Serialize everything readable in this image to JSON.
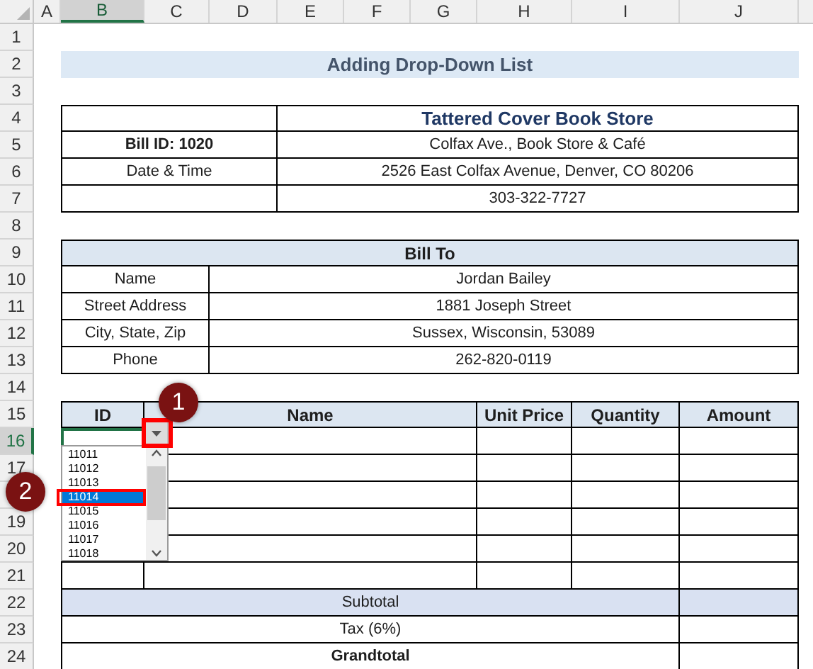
{
  "column_headers": [
    {
      "label": "A",
      "selected": false
    },
    {
      "label": "B",
      "selected": true
    },
    {
      "label": "C",
      "selected": false
    },
    {
      "label": "D",
      "selected": false
    },
    {
      "label": "E",
      "selected": false
    },
    {
      "label": "F",
      "selected": false
    },
    {
      "label": "G",
      "selected": false
    },
    {
      "label": "H",
      "selected": false
    },
    {
      "label": "I",
      "selected": false
    },
    {
      "label": "J",
      "selected": false
    }
  ],
  "row_headers": [
    {
      "label": "1",
      "selected": false
    },
    {
      "label": "2",
      "selected": false
    },
    {
      "label": "3",
      "selected": false
    },
    {
      "label": "4",
      "selected": false
    },
    {
      "label": "5",
      "selected": false
    },
    {
      "label": "6",
      "selected": false
    },
    {
      "label": "7",
      "selected": false
    },
    {
      "label": "8",
      "selected": false
    },
    {
      "label": "9",
      "selected": false
    },
    {
      "label": "10",
      "selected": false
    },
    {
      "label": "11",
      "selected": false
    },
    {
      "label": "12",
      "selected": false
    },
    {
      "label": "13",
      "selected": false
    },
    {
      "label": "14",
      "selected": false
    },
    {
      "label": "15",
      "selected": false
    },
    {
      "label": "16",
      "selected": true
    },
    {
      "label": "17",
      "selected": false
    },
    {
      "selected": false
    },
    {
      "label": "19",
      "selected": false
    },
    {
      "label": "20",
      "selected": false
    },
    {
      "label": "21",
      "selected": false
    },
    {
      "label": "22",
      "selected": false
    },
    {
      "label": "23",
      "selected": false
    },
    {
      "label": "24",
      "selected": false
    }
  ],
  "title": "Adding Drop-Down List",
  "store": {
    "name": "Tattered Cover Book Store",
    "bill_id": "Bill ID: 1020",
    "tagline": "Colfax Ave., Book Store & Café",
    "date_label": "Date & Time",
    "address": "2526 East Colfax Avenue, Denver, CO 80206",
    "phone": "303-322-7727"
  },
  "bill_to": {
    "heading": "Bill To",
    "fields": [
      {
        "label": "Name",
        "value": "Jordan Bailey"
      },
      {
        "label": "Street Address",
        "value": "1881 Joseph Street"
      },
      {
        "label": "City, State, Zip",
        "value": "Sussex, Wisconsin, 53089"
      },
      {
        "label": "Phone",
        "value": "262-820-0119"
      }
    ]
  },
  "items_table": {
    "columns": [
      "ID",
      "Name",
      "Unit Price",
      "Quantity",
      "Amount"
    ],
    "first_id_cell_selected": true
  },
  "dropdown": {
    "items": [
      {
        "label": "11011",
        "selected": false
      },
      {
        "label": "11012",
        "selected": false
      },
      {
        "label": "11013",
        "selected": false
      },
      {
        "label": "11014",
        "selected": true
      },
      {
        "label": "11015",
        "selected": false
      },
      {
        "label": "11016",
        "selected": false
      },
      {
        "label": "11017",
        "selected": false
      },
      {
        "label": "11018",
        "selected": false
      }
    ]
  },
  "totals": [
    {
      "label": "Subtotal",
      "kind": "header"
    },
    {
      "label": "Tax (6%)",
      "kind": "line"
    },
    {
      "label": "Grandtotal",
      "kind": "total"
    }
  ],
  "callouts": [
    "1",
    "2"
  ]
}
